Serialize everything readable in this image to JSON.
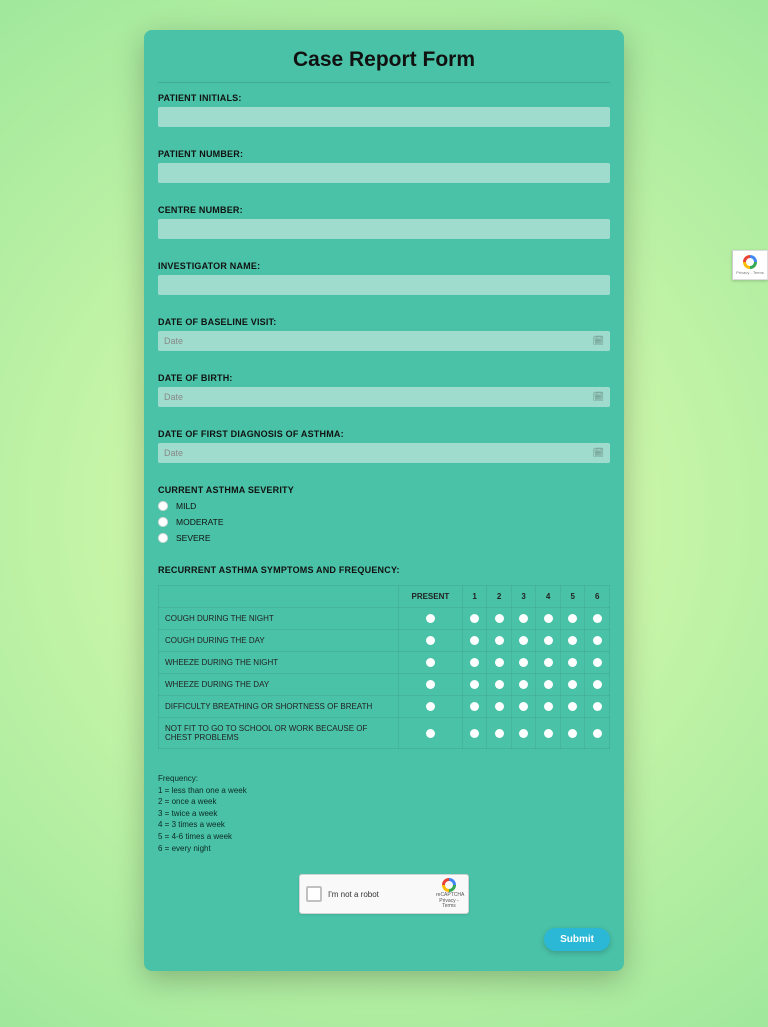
{
  "form": {
    "title": "Case Report Form",
    "fields": {
      "patient_initials": {
        "label": "PATIENT INITIALS:",
        "value": ""
      },
      "patient_number": {
        "label": "PATIENT NUMBER:",
        "value": ""
      },
      "centre_number": {
        "label": "CENTRE NUMBER:",
        "value": ""
      },
      "investigator_name": {
        "label": "INVESTIGATOR NAME:",
        "value": ""
      },
      "baseline_date": {
        "label": "DATE OF BASELINE VISIT:",
        "placeholder": "Date",
        "value": ""
      },
      "dob": {
        "label": "DATE OF BIRTH:",
        "placeholder": "Date",
        "value": ""
      },
      "first_diagnosis": {
        "label": "DATE OF FIRST DIAGNOSIS OF ASTHMA:",
        "placeholder": "Date",
        "value": ""
      }
    },
    "severity": {
      "label": "CURRENT ASTHMA SEVERITY",
      "options": [
        "MILD",
        "MODERATE",
        "SEVERE"
      ]
    },
    "matrix": {
      "label": "RECURRENT ASTHMA SYMPTOMS AND FREQUENCY:",
      "columns": [
        "PRESENT",
        "1",
        "2",
        "3",
        "4",
        "5",
        "6"
      ],
      "rows": [
        "COUGH DURING THE NIGHT",
        "COUGH DURING THE DAY",
        "WHEEZE DURING THE NIGHT",
        "WHEEZE DURING THE DAY",
        "DIFFICULTY BREATHING OR SHORTNESS OF BREATH",
        "NOT FIT TO GO TO SCHOOL OR WORK BECAUSE OF CHEST PROBLEMS"
      ]
    },
    "frequency_legend": {
      "title": "Frequency:",
      "lines": [
        "1 = less than one a week",
        "2 = once a week",
        "3 = twice a week",
        "4 = 3 times a week",
        "5 = 4-6 times a week",
        "6 = every night"
      ]
    },
    "recaptcha": {
      "text": "I'm not a robot",
      "brand": "reCAPTCHA",
      "terms": "Privacy - Terms"
    },
    "submit_label": "Submit"
  }
}
